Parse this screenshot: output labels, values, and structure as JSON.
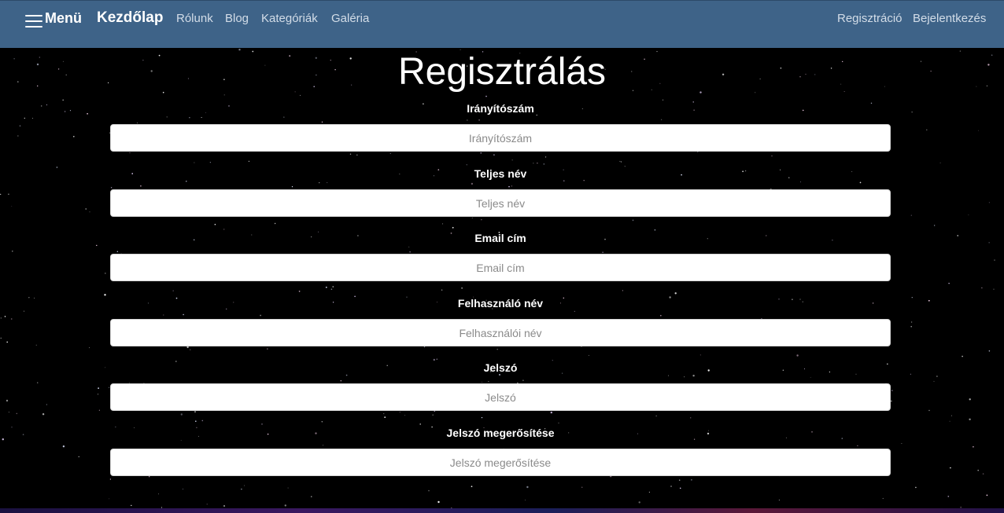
{
  "navbar": {
    "menu_label": "Menü",
    "brand": "Kezdőlap",
    "links": [
      "Rólunk",
      "Blog",
      "Kategóriák",
      "Galéria"
    ],
    "right_links": [
      "Regisztráció",
      "Bejelentkezés"
    ]
  },
  "page": {
    "title": "Regisztrálás"
  },
  "form": {
    "fields": [
      {
        "label": "Irányítószám",
        "placeholder": "Irányítószám",
        "value": ""
      },
      {
        "label": "Teljes név",
        "placeholder": "Teljes név",
        "value": ""
      },
      {
        "label": "Email cím",
        "placeholder": "Email cím",
        "value": ""
      },
      {
        "label": "Felhasználó név",
        "placeholder": "Felhasználói név",
        "value": ""
      },
      {
        "label": "Jelszó",
        "placeholder": "Jelszó",
        "value": ""
      },
      {
        "label": "Jelszó megerősítése",
        "placeholder": "Jelszó megerősítése",
        "value": ""
      }
    ]
  },
  "colors": {
    "navbar_bg": "#3e6388",
    "page_bg": "#000000",
    "nav_link": "#d3dde8"
  },
  "icons": {
    "menu": "hamburger-icon"
  }
}
